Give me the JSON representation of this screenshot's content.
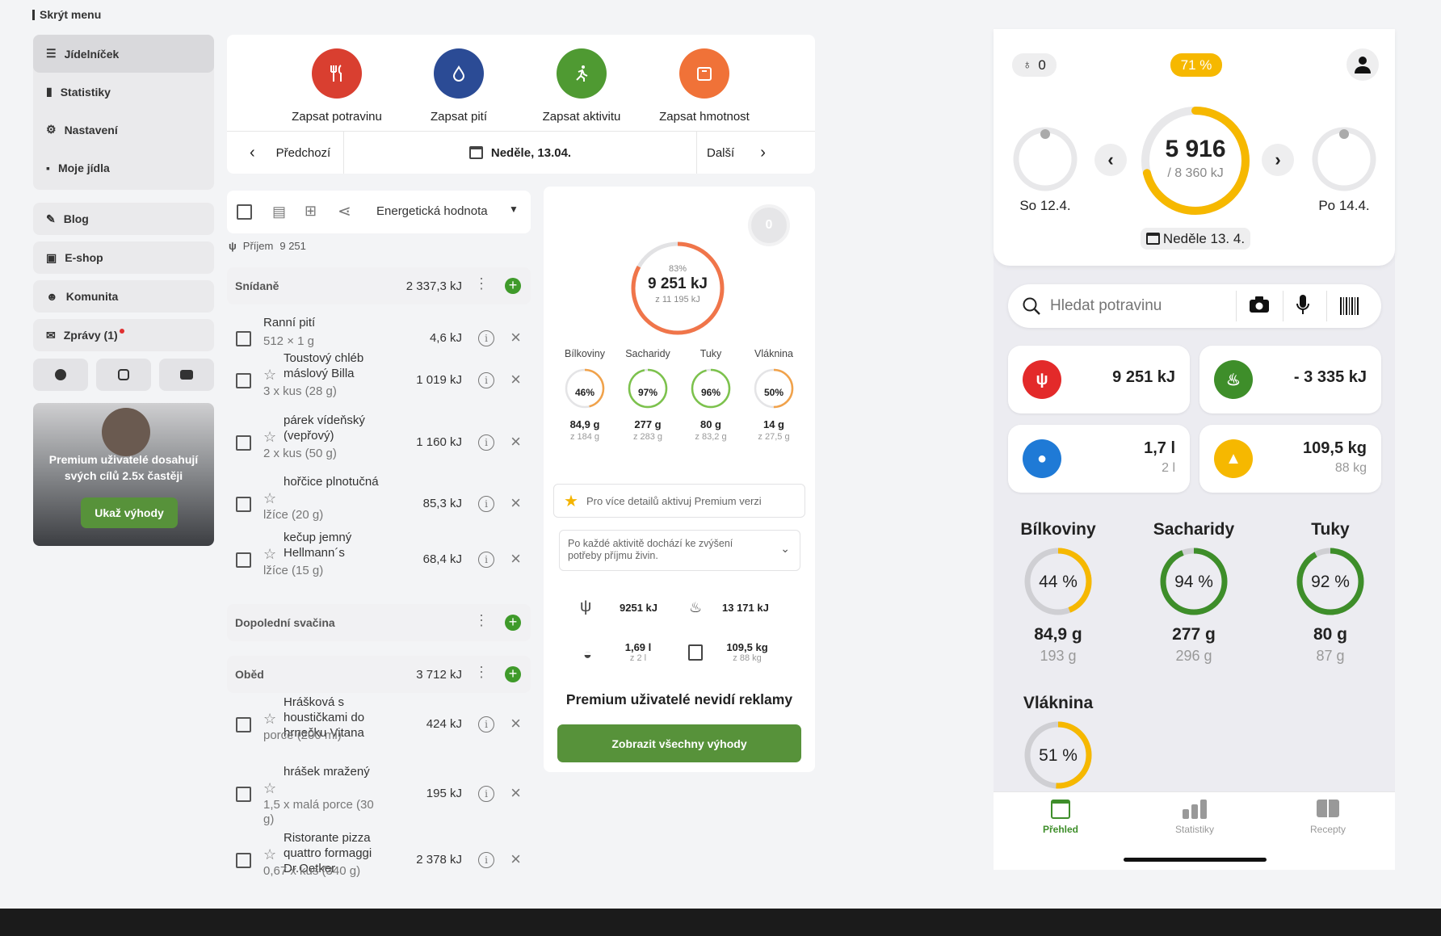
{
  "sidebar": {
    "hide_menu": "Skrýt menu",
    "items": [
      "Jídelníček",
      "Statistiky",
      "Nastavení",
      "Moje jídla"
    ],
    "blog": "Blog",
    "eshop": "E-shop",
    "community": "Komunita",
    "messages": "Zprávy (1)",
    "promo_text": "Premium uživatelé dosahují svých cílů 2.5x častěji",
    "promo_button": "Ukaž výhody"
  },
  "actions": [
    {
      "label": "Zapsat potravinu",
      "color": "#d93f30"
    },
    {
      "label": "Zapsat pití",
      "color": "#2b4b95"
    },
    {
      "label": "Zapsat aktivitu",
      "color": "#4f9a32"
    },
    {
      "label": "Zapsat hmotnost",
      "color": "#f07238"
    }
  ],
  "datenav": {
    "prev": "Předchozí",
    "date": "Neděle, 13.04.",
    "next": "Další"
  },
  "list": {
    "dropdown": "Energetická hodnota",
    "intake_label": "Příjem",
    "intake_value": "9 251",
    "breakfast": {
      "name": "Snídaně",
      "total": "2 337,3 kJ"
    },
    "breakfast_items": [
      {
        "name": "Ranní pití",
        "sub": "512 × 1 g",
        "val": "4,6  kJ"
      },
      {
        "name": "Toustový chléb máslový Billa",
        "sub": "3 x kus (28 g)",
        "val": "1 019  kJ"
      },
      {
        "name": "párek vídeňský (vepřový)",
        "sub": "2 x kus (50 g)",
        "val": "1 160  kJ"
      },
      {
        "name": "hořčice plnotučná",
        "sub": "lžíce (20 g)",
        "val": "85,3  kJ"
      },
      {
        "name": "kečup jemný Hellmann´s",
        "sub": "lžíce (15 g)",
        "val": "68,4  kJ"
      }
    ],
    "snack": {
      "name": "Dopolední svačina"
    },
    "lunch": {
      "name": "Oběd",
      "total": "3 712  kJ"
    },
    "lunch_items": [
      {
        "name": "Hrášková s houstičkami do hrnečku Vitana",
        "sub": "porce (200 ml)",
        "val": "424  kJ"
      },
      {
        "name": "hrášek mražený",
        "sub": "1,5 x malá porce (30 g)",
        "val": "195  kJ"
      },
      {
        "name": "Ristorante pizza quattro formaggi Dr.Oetker",
        "sub": "0,67 x kus (340 g)",
        "val": "2 378  kJ"
      }
    ]
  },
  "summary": {
    "badge": "0",
    "ring_pct": "83%",
    "ring_value": "9 251 kJ",
    "ring_sub": "z 11 195 kJ",
    "ring_fraction": 0.83,
    "macros": [
      {
        "name": "Bílkoviny",
        "pct": "46%",
        "val": "84,9 g",
        "goal": "z 184 g",
        "color": "#f1a24a",
        "frac": 0.46
      },
      {
        "name": "Sacharidy",
        "pct": "97%",
        "val": "277 g",
        "goal": "z 283 g",
        "color": "#7cc24c",
        "frac": 0.97
      },
      {
        "name": "Tuky",
        "pct": "96%",
        "val": "80 g",
        "goal": "z 83,2 g",
        "color": "#7cc24c",
        "frac": 0.96
      },
      {
        "name": "Vláknina",
        "pct": "50%",
        "val": "14 g",
        "goal": "z 27,5 g",
        "color": "#f1a24a",
        "frac": 0.5
      }
    ],
    "premium_hint": "Pro více detailů aktivuj Premium verzi",
    "activity_note": "Po každé aktivitě dochází ke zvýšení potřeby příjmu živin.",
    "stats": {
      "food": "9251 kJ",
      "burn": "13 171 kJ",
      "water": "1,69 l",
      "water_goal": "z 2 l",
      "weight": "109,5 kg",
      "weight_goal": "z 88 kg"
    },
    "no_ads": "Premium uživatelé nevidí reklamy",
    "cta": "Zobrazit všechny výhody"
  },
  "phone": {
    "badge_count": "0",
    "pct_pill": "71 %",
    "center_value": "5 916",
    "center_goal": "/ 8 360 kJ",
    "center_fraction": 0.71,
    "prev_day": "So 12.4.",
    "next_day": "Po 14.4.",
    "today": "Neděle 13. 4.",
    "search_placeholder": "Hledat potravinu",
    "tiles": [
      {
        "value": "9 251 kJ",
        "sub": "",
        "color": "#e32a2a"
      },
      {
        "value": "- 3 335 kJ",
        "sub": "",
        "color": "#3e8e2a"
      },
      {
        "value": "1,7 l",
        "sub": "2 l",
        "color": "#1f7ad6"
      },
      {
        "value": "109,5 kg",
        "sub": "88 kg",
        "color": "#f6b800"
      }
    ],
    "macros": [
      {
        "name": "Bílkoviny",
        "pct": "44 %",
        "val": "84,9 g",
        "goal": "193 g",
        "color": "#f6b800",
        "frac": 0.44
      },
      {
        "name": "Sacharidy",
        "pct": "94 %",
        "val": "277 g",
        "goal": "296 g",
        "color": "#3e8e2a",
        "frac": 0.94
      },
      {
        "name": "Tuky",
        "pct": "92 %",
        "val": "80 g",
        "goal": "87 g",
        "color": "#3e8e2a",
        "frac": 0.92
      },
      {
        "name": "Vláknina",
        "pct": "51 %",
        "val": "",
        "goal": "",
        "color": "#f6b800",
        "frac": 0.51
      }
    ],
    "tabs": [
      "Přehled",
      "Statistiky",
      "Recepty"
    ]
  }
}
